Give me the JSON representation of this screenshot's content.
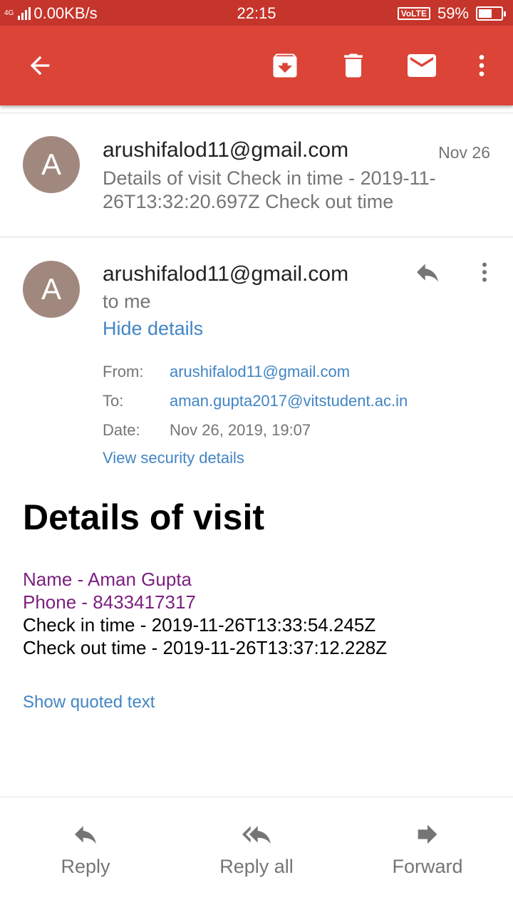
{
  "status_bar": {
    "network": "4G",
    "speed": "0.00KB/s",
    "time": "22:15",
    "volte": "VoLTE",
    "battery": "59%",
    "battery_level": 0.59
  },
  "app_bar": {
    "back_icon": "arrow-left-icon",
    "archive_icon": "archive-icon",
    "delete_icon": "trash-icon",
    "mark_unread_icon": "mail-icon",
    "more_icon": "more-vertical-icon"
  },
  "collapsed_message": {
    "avatar_letter": "A",
    "sender": "arushifalod11@gmail.com",
    "date": "Nov 26",
    "snippet": "Details of visit Check in time - 2019-11-26T13:32:20.697Z Check out time"
  },
  "expanded_message": {
    "avatar_letter": "A",
    "sender": "arushifalod11@gmail.com",
    "to_me": "to me",
    "hide_details": "Hide details",
    "details": {
      "from_label": "From:",
      "from_value": "arushifalod11@gmail.com",
      "to_label": "To:",
      "to_value": "aman.gupta2017@vitstudent.ac.in",
      "date_label": "Date:",
      "date_value": "Nov 26, 2019, 19:07"
    },
    "view_security": "View security details",
    "body": {
      "title": "Details of visit",
      "name": "Name - Aman Gupta",
      "phone": "Phone - 8433417317",
      "check_in": "Check in time - 2019-11-26T13:33:54.245Z",
      "check_out": "Check out time - 2019-11-26T13:37:12.228Z"
    },
    "show_quoted": "Show quoted text"
  },
  "bottom_actions": {
    "reply": "Reply",
    "reply_all": "Reply all",
    "forward": "Forward"
  },
  "colors": {
    "app_bar": "#db4437",
    "status_bar": "#c5352b",
    "avatar": "#a1887f",
    "link": "#4285c4",
    "body_purple": "#7b1f7f"
  }
}
